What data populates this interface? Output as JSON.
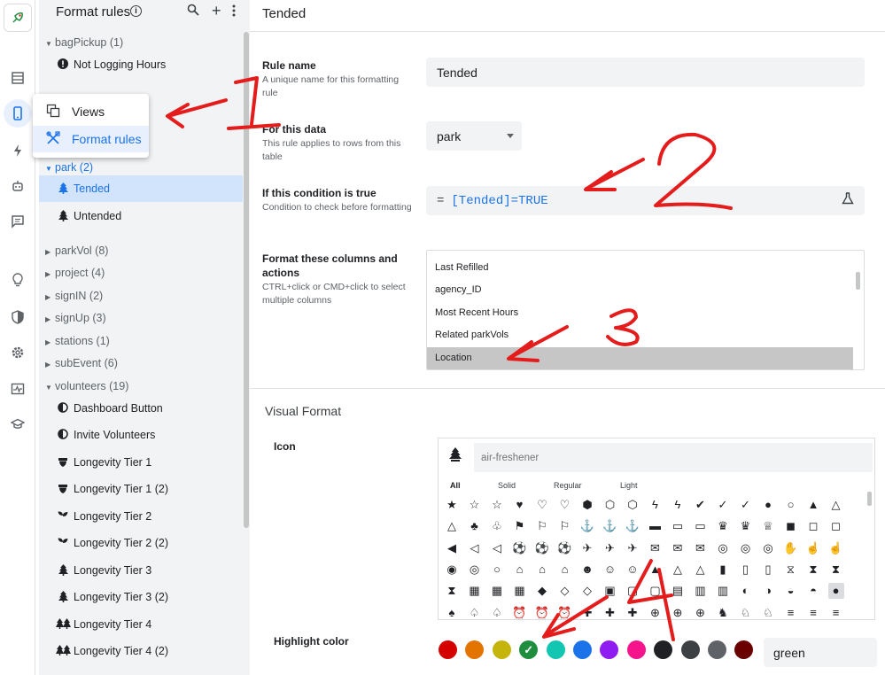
{
  "sidebar_rail": {
    "icons": [
      "app-logo-icon",
      "data-icon",
      "views-icon",
      "actions-icon",
      "automation-icon",
      "chat-icon",
      "intelligence-icon",
      "security-icon",
      "settings-icon",
      "monitor-icon",
      "learn-icon"
    ]
  },
  "panel": {
    "title": "Format rules",
    "groups": [
      {
        "name": "bagPickup (1)",
        "expanded": true,
        "items": [
          {
            "label": "Not Logging Hours",
            "icon": "alert-circle-icon"
          }
        ]
      },
      {
        "name": "park (2)",
        "expanded": true,
        "selected": true,
        "items": [
          {
            "label": "Tended",
            "icon": "tree-icon",
            "selected": true
          },
          {
            "label": "Untended",
            "icon": "tree-icon"
          }
        ]
      },
      {
        "name": "parkVol (8)"
      },
      {
        "name": "project (4)"
      },
      {
        "name": "signIN (2)"
      },
      {
        "name": "signUp (3)"
      },
      {
        "name": "stations (1)"
      },
      {
        "name": "subEvent (6)"
      },
      {
        "name": "volunteers (19)",
        "expanded": true,
        "items": [
          {
            "label": "Dashboard Button",
            "icon": "contrast-icon"
          },
          {
            "label": "Invite Volunteers",
            "icon": "contrast-icon"
          },
          {
            "label": "Longevity Tier 1",
            "icon": "acorn-icon"
          },
          {
            "label": "Longevity Tier 1 (2)",
            "icon": "acorn-icon"
          },
          {
            "label": "Longevity Tier 2",
            "icon": "seedling-icon"
          },
          {
            "label": "Longevity Tier 2 (2)",
            "icon": "seedling-icon"
          },
          {
            "label": "Longevity Tier 3",
            "icon": "tree-icon"
          },
          {
            "label": "Longevity Tier 3 (2)",
            "icon": "tree-icon"
          },
          {
            "label": "Longevity Tier 4",
            "icon": "trees-icon"
          },
          {
            "label": "Longevity Tier 4 (2)",
            "icon": "trees-icon"
          }
        ]
      }
    ]
  },
  "popup": {
    "views": "Views",
    "format_rules": "Format rules"
  },
  "main": {
    "title": "Tended",
    "rule_name_label": "Rule name",
    "rule_name_desc": "A unique name for this formatting rule",
    "rule_name_value": "Tended",
    "data_label": "For this data",
    "data_desc": "This rule applies to rows from this table",
    "data_value": "park",
    "condition_label": "If this condition is true",
    "condition_desc": "Condition to check before formatting",
    "condition_eq": "=",
    "condition_value": "[Tended]=TRUE",
    "columns_label": "Format these columns and actions",
    "columns_desc": "CTRL+click or CMD+click to select multiple columns",
    "columns": [
      "Last Refilled",
      "agency_ID",
      "Most Recent Hours",
      "Related parkVols",
      "Location"
    ],
    "selected_column": "Location",
    "visual_format": "Visual Format",
    "icon_label": "Icon",
    "icon_search_placeholder": "air-freshener",
    "icon_tabs": [
      "All",
      "Solid",
      "Regular",
      "Light"
    ],
    "highlight_label": "Highlight color",
    "colors": [
      "#d50000",
      "#e37400",
      "#c5b40b",
      "#1e8e3e",
      "#12c6b2",
      "#1a73e8",
      "#8f1cf0",
      "#f5148c",
      "#202124",
      "#3c4043",
      "#5f6368",
      "#6a0000"
    ],
    "selected_color_index": 3,
    "color_value": "green"
  },
  "annotations": [
    "1",
    "2",
    "3",
    "4"
  ]
}
